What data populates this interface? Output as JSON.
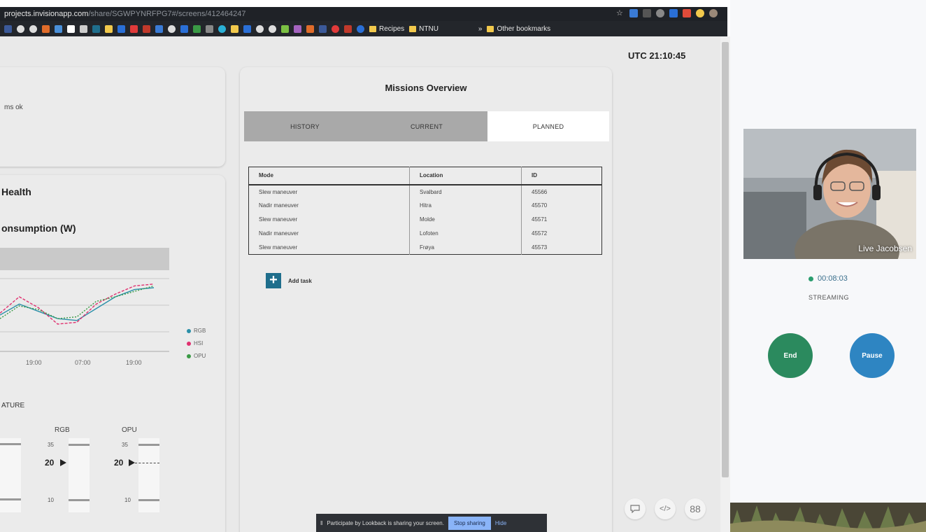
{
  "browser": {
    "url_host": "projects.invisionapp.com",
    "url_path": "/share/SGWPYNRFPG7#/screens/412464247",
    "bookmarks": [
      {
        "label": "Recipes"
      },
      {
        "label": "NTNU"
      },
      {
        "label": "Other bookmarks"
      }
    ],
    "overflow_label": "»"
  },
  "header": {
    "utc_clock": "UTC 21:10:45"
  },
  "status_card": {
    "text": "ms ok"
  },
  "health_card": {
    "title": "Health",
    "power_title": "onsumption (W)",
    "temperature_title": "ATURE"
  },
  "chart_data": {
    "type": "line",
    "title": "",
    "xlabel": "",
    "ylabel": "",
    "categories": [
      "19:00",
      "07:00",
      "19:00"
    ],
    "series": [
      {
        "name": "RGB",
        "color": "#2a8fa8",
        "values": [
          40,
          52,
          44,
          36,
          34,
          47,
          60,
          68,
          70
        ]
      },
      {
        "name": "HSI",
        "color": "#e0306f",
        "values": [
          42,
          60,
          48,
          30,
          32,
          52,
          63,
          72,
          74
        ]
      },
      {
        "name": "OPU",
        "color": "#3a9a45",
        "values": [
          36,
          50,
          46,
          36,
          38,
          55,
          60,
          66,
          72
        ]
      }
    ],
    "legend": "right"
  },
  "gauges": [
    {
      "name": "RGB",
      "max": "35",
      "value": "20",
      "min": "10"
    },
    {
      "name": "OPU",
      "max": "35",
      "value": "20",
      "min": "10"
    }
  ],
  "missions": {
    "title": "Missions Overview",
    "tabs": [
      {
        "label": "HISTORY",
        "active": false
      },
      {
        "label": "CURRENT",
        "active": false
      },
      {
        "label": "PLANNED",
        "active": true
      }
    ],
    "columns": [
      "Mode",
      "Location",
      "ID"
    ],
    "rows": [
      [
        "Slew maneuver",
        "Svalbard",
        "45566"
      ],
      [
        "Nadir maneuver",
        "Hitra",
        "45570"
      ],
      [
        "Slew maneuver",
        "Molde",
        "45571"
      ],
      [
        "Nadir maneuver",
        "Lofoten",
        "45572"
      ],
      [
        "Slew maneuver",
        "Frøya",
        "45573"
      ]
    ],
    "add_task_label": "Add task"
  },
  "toolbar": {
    "comment_icon": "comment-icon",
    "code_icon": "</>",
    "grid_icon": "88"
  },
  "share_banner": {
    "text": "Participate by Lookback is sharing your screen.",
    "stop_label": "Stop sharing",
    "hide_label": "Hide"
  },
  "call": {
    "participant_name": "Live Jacobsen",
    "timer": "00:08:03",
    "status": "STREAMING",
    "end_label": "End",
    "pause_label": "Pause"
  }
}
